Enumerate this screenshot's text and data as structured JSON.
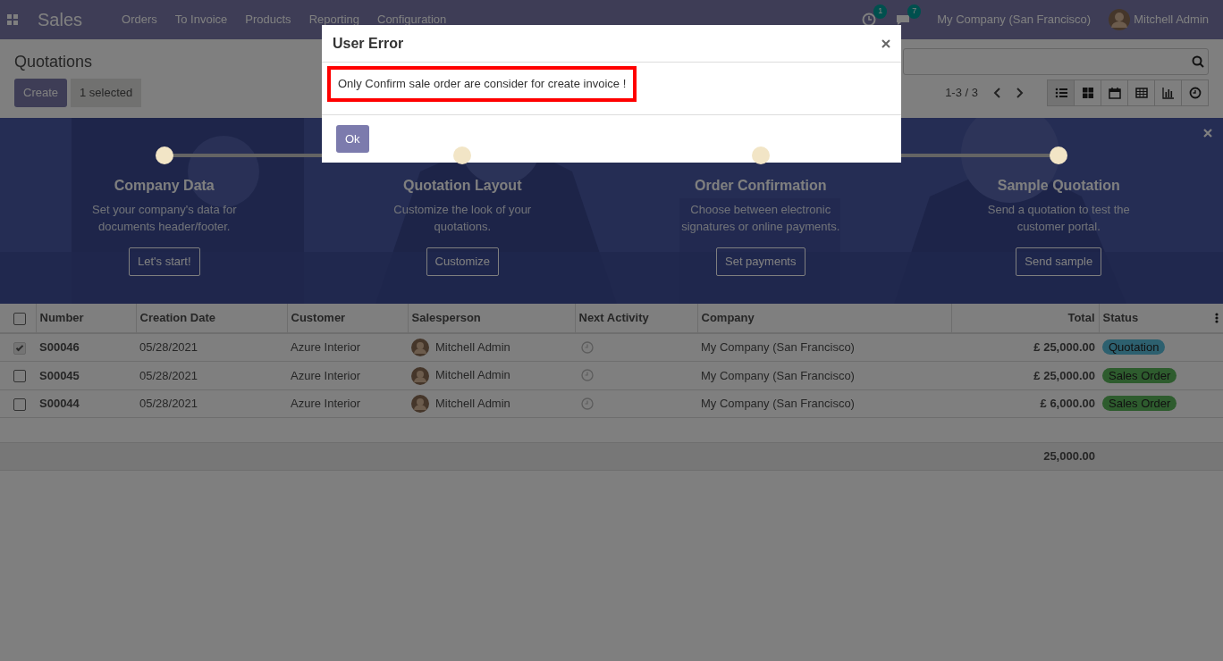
{
  "navbar": {
    "app": "Sales",
    "menu": [
      "Orders",
      "To Invoice",
      "Products",
      "Reporting",
      "Configuration"
    ],
    "activity_count": "1",
    "message_count": "7",
    "company": "My Company (San Francisco)",
    "user": "Mitchell Admin"
  },
  "control_panel": {
    "breadcrumb": "Quotations",
    "create": "Create",
    "selection": "1 selected",
    "pager": "1-3 / 3",
    "views": [
      {
        "kind": "list",
        "selected": true
      },
      {
        "kind": "kanban",
        "selected": false
      },
      {
        "kind": "calendar",
        "selected": false
      },
      {
        "kind": "pivot",
        "selected": false
      },
      {
        "kind": "graph",
        "selected": false
      },
      {
        "kind": "activity",
        "selected": false
      }
    ]
  },
  "onboarding": {
    "steps": [
      {
        "title": "Company Data",
        "description": "Set your company's data for documents header/footer.",
        "button": "Let's start!"
      },
      {
        "title": "Quotation Layout",
        "description": "Customize the look of your quotations.",
        "button": "Customize"
      },
      {
        "title": "Order Confirmation",
        "description": "Choose between electronic signatures or online payments.",
        "button": "Set payments"
      },
      {
        "title": "Sample Quotation",
        "description": "Send a quotation to test the customer portal.",
        "button": "Send sample"
      }
    ]
  },
  "table": {
    "columns": [
      "Number",
      "Creation Date",
      "Customer",
      "Salesperson",
      "Next Activity",
      "Company",
      "Total",
      "Status"
    ],
    "rows": [
      {
        "selected": true,
        "number": "S00046",
        "date": "05/28/2021",
        "customer": "Azure Interior",
        "salesperson": "Mitchell Admin",
        "company": "My Company (San Francisco)",
        "total": "£ 25,000.00",
        "status": {
          "label": "Quotation",
          "kind": "quotation"
        }
      },
      {
        "selected": false,
        "number": "S00045",
        "date": "05/28/2021",
        "customer": "Azure Interior",
        "salesperson": "Mitchell Admin",
        "company": "My Company (San Francisco)",
        "total": "£ 25,000.00",
        "status": {
          "label": "Sales Order",
          "kind": "sale"
        }
      },
      {
        "selected": false,
        "number": "S00044",
        "date": "05/28/2021",
        "customer": "Azure Interior",
        "salesperson": "Mitchell Admin",
        "company": "My Company (San Francisco)",
        "total": "£ 6,000.00",
        "status": {
          "label": "Sales Order",
          "kind": "sale"
        }
      }
    ],
    "all_selected": false,
    "footer_total": "25,000.00"
  },
  "dialog": {
    "title": "User Error",
    "message": "Only Confirm sale order are consider for create invoice !",
    "button": "Ok"
  }
}
